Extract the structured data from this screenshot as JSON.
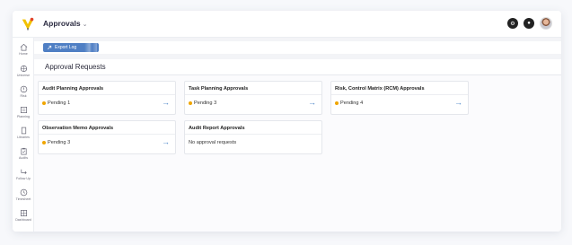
{
  "app": {
    "title": "Approvals",
    "title_chevron": "⌄"
  },
  "sidebar": {
    "items": [
      {
        "label": "Home",
        "icon": "home-icon"
      },
      {
        "label": "Universe",
        "icon": "universe-icon"
      },
      {
        "label": "Risk",
        "icon": "risk-icon"
      },
      {
        "label": "Planning",
        "icon": "planning-icon"
      },
      {
        "label": "Libraries",
        "icon": "libraries-icon"
      },
      {
        "label": "Audits",
        "icon": "audits-icon"
      },
      {
        "label": "Follow Up",
        "icon": "follow-up-icon"
      },
      {
        "label": "Timesheet",
        "icon": "timesheet-icon"
      },
      {
        "label": "Dashboard",
        "icon": "dashboard-icon"
      }
    ]
  },
  "toolbar": {
    "export_label": "Export Log"
  },
  "section": {
    "title": "Approval Requests"
  },
  "cards": [
    {
      "title": "Audit Planning Approvals",
      "status": "Pending 1",
      "has_pending": true
    },
    {
      "title": "Task Planning Approvals",
      "status": "Pending 3",
      "has_pending": true
    },
    {
      "title": "Risk, Control Matrix (RCM) Approvals",
      "status": "Pending 4",
      "has_pending": true
    },
    {
      "title": "Observation Memo Approvals",
      "status": "Pending 3",
      "has_pending": true
    },
    {
      "title": "Audit Report Approvals",
      "status": "No approval requests",
      "has_pending": false
    }
  ],
  "colors": {
    "accent": "#4f7fc4",
    "pending_dot": "#f0a500",
    "arrow": "#4a86c8"
  }
}
